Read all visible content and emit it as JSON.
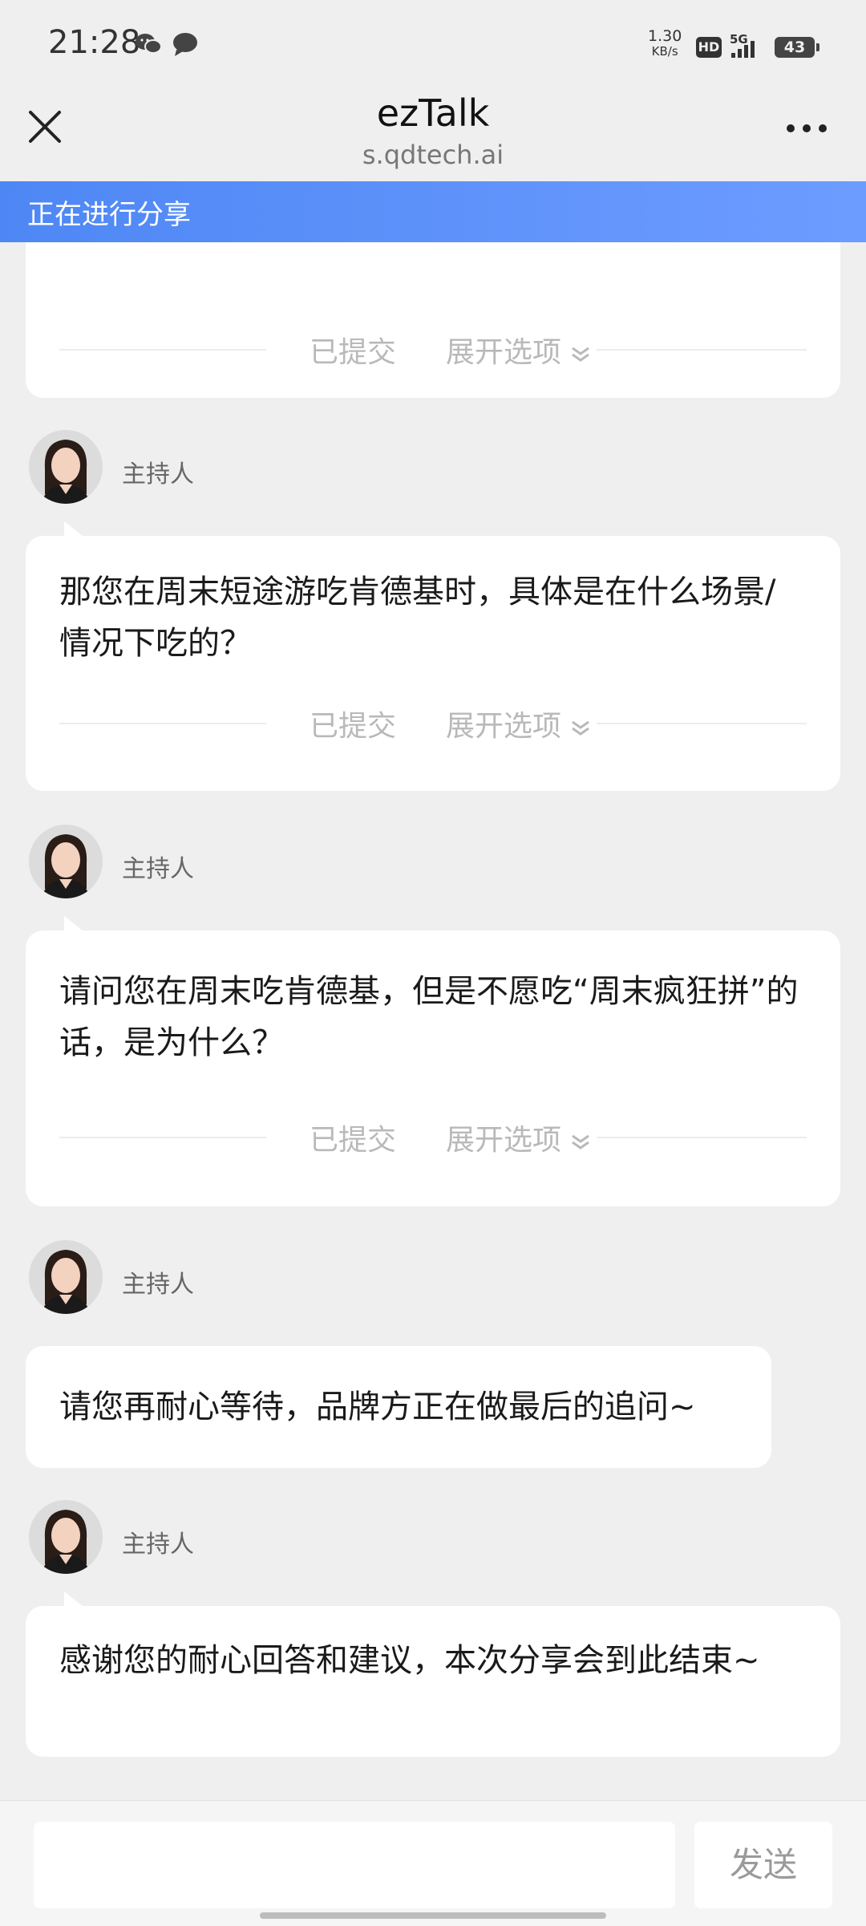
{
  "status_bar": {
    "time": "21:28",
    "net_speed_value": "1.30",
    "net_speed_unit": "KB/s",
    "hd_label": "HD",
    "network_label": "5G",
    "battery": "43"
  },
  "nav": {
    "title": "ezTalk",
    "subtitle": "s.qdtech.ai"
  },
  "banner": {
    "text": "正在进行分享"
  },
  "labels": {
    "submitted": "已提交",
    "expand": "展开选项"
  },
  "messages": [
    {
      "host": "主持人",
      "text": "那您在周末短途游吃肯德基时，具体是在什么场景/情况下吃的？"
    },
    {
      "host": "主持人",
      "text": "请问您在周末吃肯德基，但是不愿吃“周末疯狂拼”的话，是为什么？"
    },
    {
      "host": "主持人",
      "text": "请您再耐心等待，品牌方正在做最后的追问~"
    },
    {
      "host": "主持人",
      "text": "感谢您的耐心回答和建议，本次分享会到此结束~"
    }
  ],
  "input": {
    "placeholder": "",
    "send_label": "发送"
  }
}
